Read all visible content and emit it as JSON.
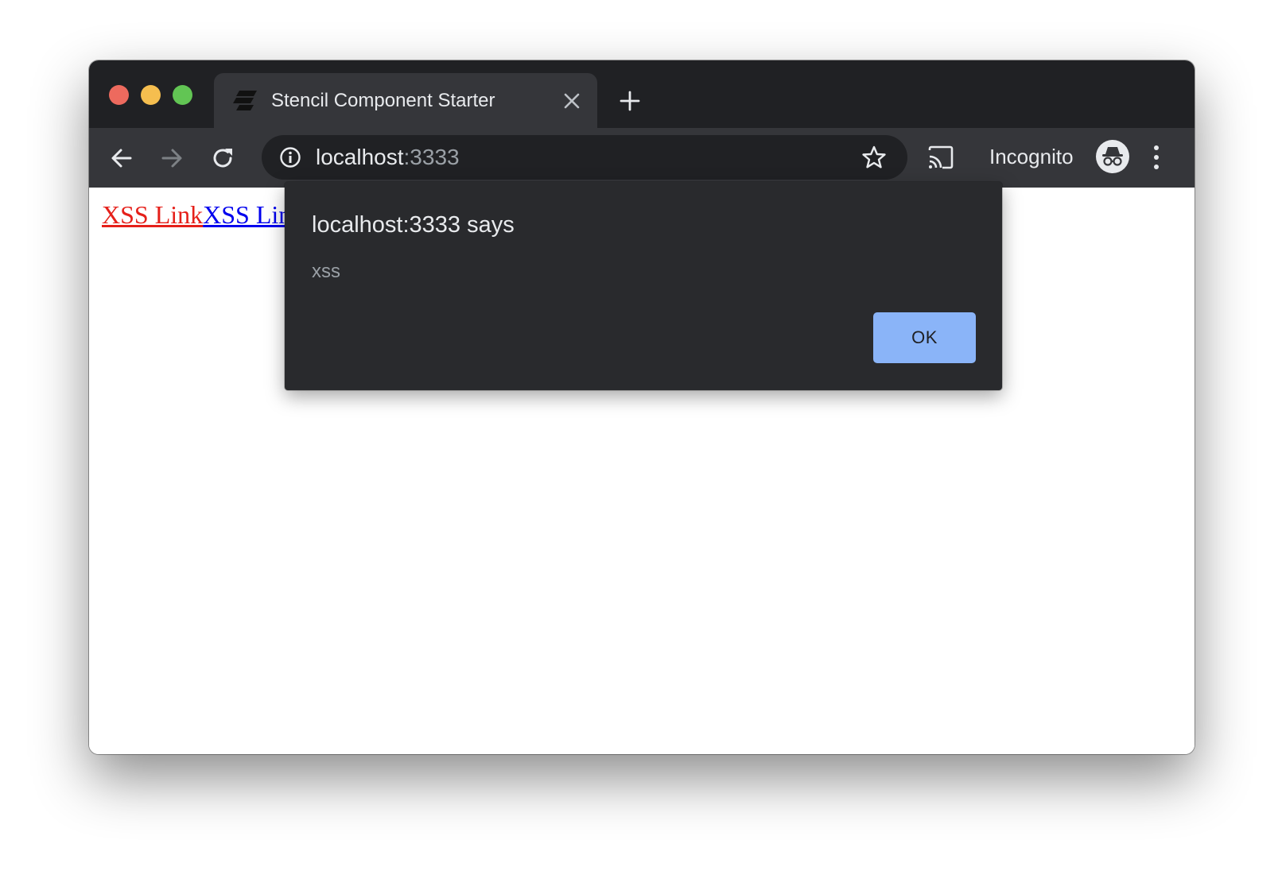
{
  "window": {
    "tab": {
      "title": "Stencil Component Starter",
      "favicon": "stencil-logo-icon"
    },
    "toolbar": {
      "back_icon": "arrow-left-icon",
      "forward_icon": "arrow-right-icon",
      "reload_icon": "reload-icon",
      "address": {
        "host": "localhost",
        "port": ":3333"
      },
      "incognito_label": "Incognito"
    }
  },
  "page": {
    "links": [
      {
        "text": "XSS Link",
        "color": "#e5201a"
      },
      {
        "text": "XSS Lin",
        "color": "#0000ee"
      }
    ]
  },
  "dialog": {
    "title": "localhost:3333 says",
    "message": "xss",
    "ok_label": "OK"
  },
  "colors": {
    "tabstrip": "#202124",
    "toolbar": "#35363a",
    "dialog_bg": "#292a2d",
    "ok_button": "#8ab4f8"
  }
}
